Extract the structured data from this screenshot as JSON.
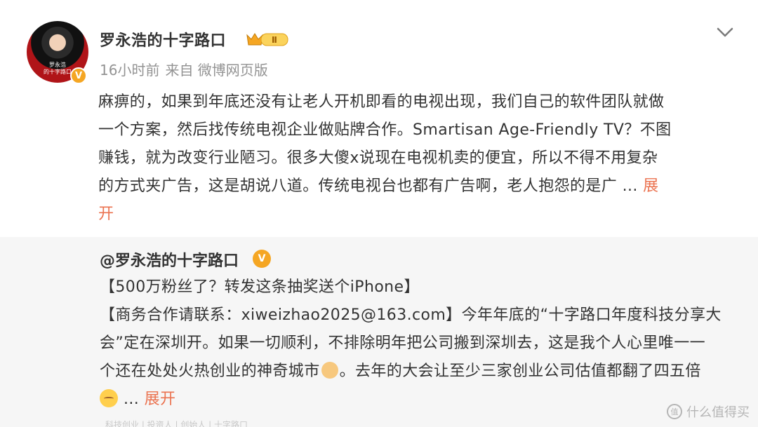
{
  "post": {
    "username": "罗永浩的十字路口",
    "avatar_caption": "罗永浩\n的十字路口",
    "verify_mark": "V",
    "vip_level": "Ⅱ",
    "time": "16小时前",
    "source": "来自 微博网页版",
    "lines": [
      "麻痹的，如果到年底还没有让老人开机即看的电视出现，我们自己的软件团队就做",
      "一个方案，然后找传统电视企业做贴牌合作。Smartisan Age-Friendly TV？不图",
      "赚钱，就为改变行业陋习。很多大傻x说现在电视机卖的便宜，所以不得不用复杂",
      "的方式夹广告，这是胡说八道。传统电视台也都有广告啊，老人抱怨的是广 ... "
    ],
    "expand_part1": "展",
    "expand_part2": "开"
  },
  "repost": {
    "username": "@罗永浩的十字路口",
    "verify_mark": "V",
    "line1": "【500万粉丝了？转发这条抽奖送个iPhone】",
    "line2": "【商务合作请联系：xiweizhao2025@163.com】今年年底的“十字路口年度科技分享大",
    "line3": "会”定在深圳开。如果一切顺利，不排除明年把公司搬到深圳去，这是我个人心里唯一一",
    "line4a": "个还在处处火热创业的神奇城市",
    "line4b": "。去年的大会让至少三家创业公司估值都翻了四五倍",
    "line5_ellipsis": "... ",
    "expand": "展开",
    "bottom_partial": "科技创业 | 投资人 | 创始人 | 十字路口"
  },
  "watermark": {
    "icon": "值",
    "text": "什么值得买"
  },
  "colors": {
    "accent": "#eb7350",
    "gold": "#f5a623",
    "meta_gray": "#939393",
    "repost_bg": "#f6f6f6"
  }
}
